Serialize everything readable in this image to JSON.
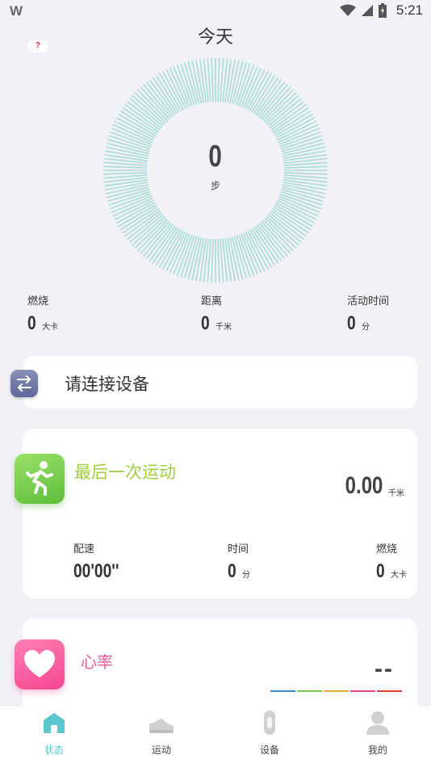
{
  "status_bar": {
    "time": "5:21",
    "logo": "W"
  },
  "page_title": "今天",
  "help_badge": "?",
  "steps": {
    "value": "0",
    "unit": "步",
    "ring_color": "#9ad8d3"
  },
  "summary": {
    "burn": {
      "label": "燃烧",
      "value": "0",
      "unit": "大卡"
    },
    "distance": {
      "label": "距离",
      "value": "0",
      "unit": "千米"
    },
    "active_time": {
      "label": "活动时间",
      "value": "0",
      "unit": "分"
    }
  },
  "connect": {
    "label": "请连接设备",
    "icon": "swap-arrows-icon"
  },
  "last_sport": {
    "title": "最后一次运动",
    "title_color": "#9ecf3c",
    "distance_value": "0.00",
    "distance_unit": "千米",
    "pace": {
      "label": "配速",
      "value": "00'00''"
    },
    "time": {
      "label": "时间",
      "value": "0",
      "unit": "分"
    },
    "burn": {
      "label": "燃烧",
      "value": "0",
      "unit": "大卡"
    }
  },
  "heart_rate": {
    "title": "心率",
    "title_color": "#e45a9a",
    "value": "--",
    "zone_colors": [
      "#2f86d6",
      "#7cc84a",
      "#f4a82c",
      "#e23f8a",
      "#e03c32"
    ]
  },
  "nav": [
    {
      "label": "状态",
      "icon": "home-icon",
      "active": true
    },
    {
      "label": "运动",
      "icon": "sneaker-icon",
      "active": false
    },
    {
      "label": "设备",
      "icon": "band-icon",
      "active": false
    },
    {
      "label": "我的",
      "icon": "profile-icon",
      "active": false
    }
  ],
  "accent_color": "#5cc7cf"
}
